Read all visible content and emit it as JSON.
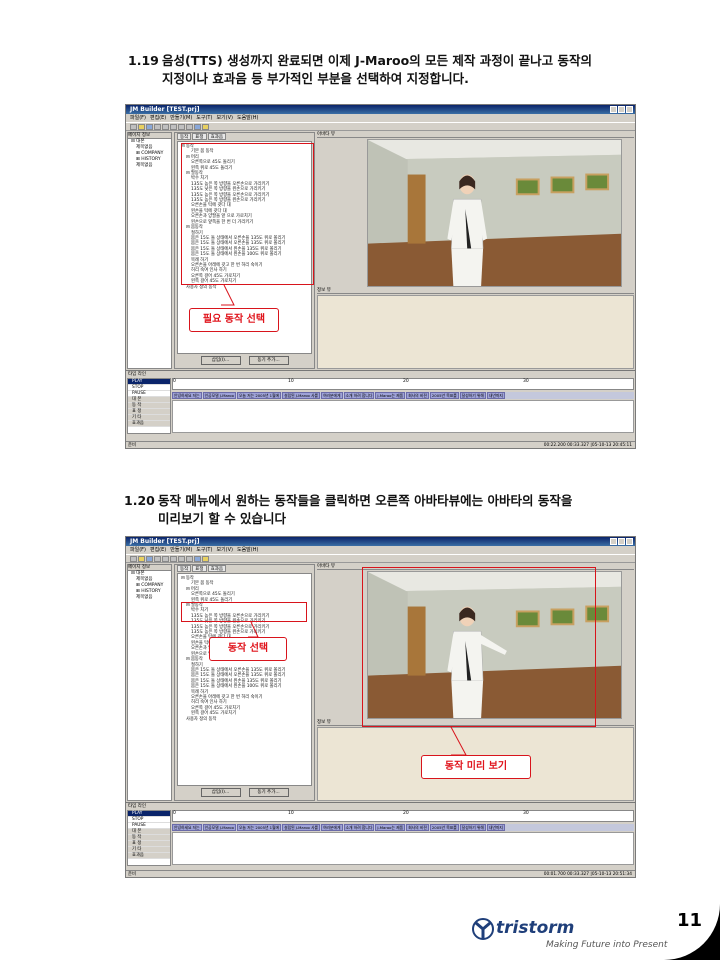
{
  "captions": [
    {
      "num": "1.19",
      "line1": "음성(TTS) 생성까지 완료되면 이제 J-Maroo의 모든 제작 과정이 끝나고 동작의",
      "line2": "지정이나 효과음 등 부가적인 부분을 선택하여 지정합니다."
    },
    {
      "num": "1.20",
      "line1": "동작 메뉴에서 원하는 동작들을 클릭하면 오른쪽 아바타뷰에는 아바타의 동작을",
      "line2": "미리보기 할 수 있습니다"
    }
  ],
  "app": {
    "title": "JM Builder [TEST.prj]",
    "menu": [
      "파일(F)",
      "편집(E)",
      "만들기(M)",
      "도구(T)",
      "보기(V)",
      "도움말(H)"
    ],
    "page_panel": "페이지 정보",
    "page_tree": [
      "⊟ 대본",
      "제목없음",
      "⊞ COMPANY",
      "⊞ HISTORY",
      "제목없음"
    ],
    "tabs": [
      "동작",
      "표정",
      "효과음"
    ],
    "motion_tree": [
      "⊟ 동작",
      "기본 몸 동작",
      "⊟ 머리",
      "오른쪽으로 45도 돌리기",
      "왼쪽 위로 45도 돌리기",
      "⊟ 팔동작",
      "박수 치기",
      "135도 높은 쪽 방향을 오른손으로 가리키기",
      "135도 낮은 쪽 방향을 왼손으로 가리키기",
      "135도 높은 쪽 방향을 오른손으로 가리키기",
      "135도 높은 쪽 방향을 왼손으로 가리키기",
      "오른손을 턱에 갖다 대",
      "왼손을 턱에 갖다 대",
      "오른손과 양팔을 앞 으로 가로치기",
      "왼손으로 앞쪽을 한 번 더 가리키기",
      "⊟ 몸동작",
      "절하기",
      "몸은 15도 돌 상태에서 오른손을 135도 위로 올리기",
      "몸은 15도 돌 상태에서 오른손을 135도 위로 올리기",
      "몸은 15도 돌 상태에서 왼손을 135도 위로 올리기",
      "몸은 15도 돌 상태에서 왼손을 100도 위로 올리기",
      "목례 하기",
      "오른손을 아래에 갖고 한 번 허리 숙이기",
      "허리 숙여 인사 하기",
      "오른쪽 걸어 45도 가로치기",
      "왼쪽 걸어 45도 가로치기",
      "사용자 정의 동작"
    ],
    "btn_insert": "삽입(I)...",
    "btn_add": "동기 추가...",
    "view_avatar": "아바타 뷰",
    "view_info": "정보 뷰",
    "timeline": "타임 라인",
    "ctrl": [
      "PLAY",
      "STOP",
      "PAUSE",
      "대 본",
      "동 작",
      "표 정",
      "기 타",
      "효과음"
    ],
    "ruler": [
      "0",
      "10",
      "20",
      "30"
    ],
    "track1": [
      "안녕하세요 저는",
      "인공모델 J-Maroo",
      "오늘 저는 2005년 1월에",
      "설립된 J-Maroo 사를",
      "여러분에게",
      "소개 하려 합니다",
      "J-Maroo는 제품",
      "회사의 비젼",
      "2005년 목표를",
      "달성하기 위해",
      "내년까지"
    ],
    "status_left": "준비",
    "status_right_1": "00:22.200 00:33.327 |05-10-13 20:45:11",
    "status_right_2": "00:01.700 00:33.327 |05-10-13 20:51:34"
  },
  "callouts": [
    "필요 동작 선택",
    "동작 선택",
    "동작 미리 보기"
  ],
  "page_number": "11",
  "logo": {
    "name": "tristorm",
    "slogan": "Making Future into Present"
  },
  "colors": {
    "accent": "#d8141c",
    "titlebar": "#0a246a",
    "logo": "#1f3f7a"
  }
}
